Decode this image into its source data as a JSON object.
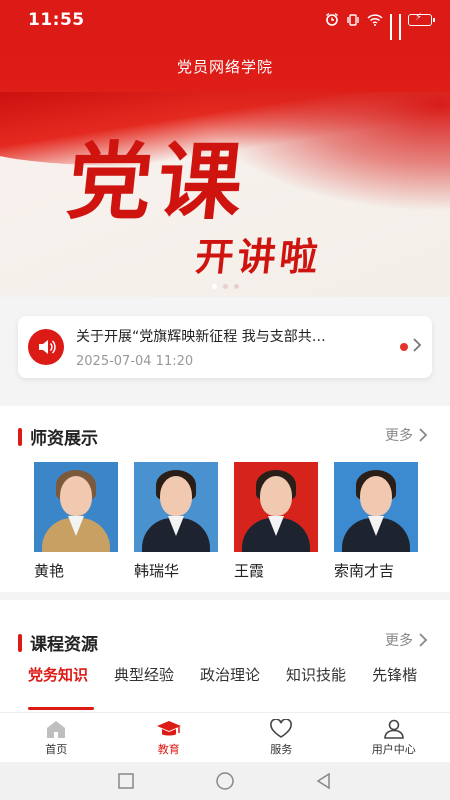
{
  "status": {
    "time": "11:55"
  },
  "appbar": {
    "title": "党员网络学院"
  },
  "banner": {
    "title_big": "党课",
    "title_small": "开讲啦"
  },
  "notice": {
    "headline": "关于开展“党旗辉映新征程 我与支部共…",
    "date": "2025-07-04 11:20"
  },
  "teachers_section": {
    "title": "师资展示",
    "more": "更多",
    "teachers": [
      {
        "name": "黄艳"
      },
      {
        "name": "韩瑞华"
      },
      {
        "name": "王霞"
      },
      {
        "name": "索南才吉"
      }
    ]
  },
  "courses_section": {
    "title": "课程资源",
    "more": "更多",
    "tabs": [
      "党务知识",
      "典型经验",
      "政治理论",
      "知识技能",
      "先锋楷"
    ]
  },
  "bottom_nav": [
    {
      "label": "首页",
      "icon": "home-icon"
    },
    {
      "label": "教育",
      "icon": "graduation-cap-icon"
    },
    {
      "label": "服务",
      "icon": "heart-icon"
    },
    {
      "label": "用户中心",
      "icon": "user-icon"
    }
  ],
  "colors": {
    "brand": "#dc1a16"
  }
}
